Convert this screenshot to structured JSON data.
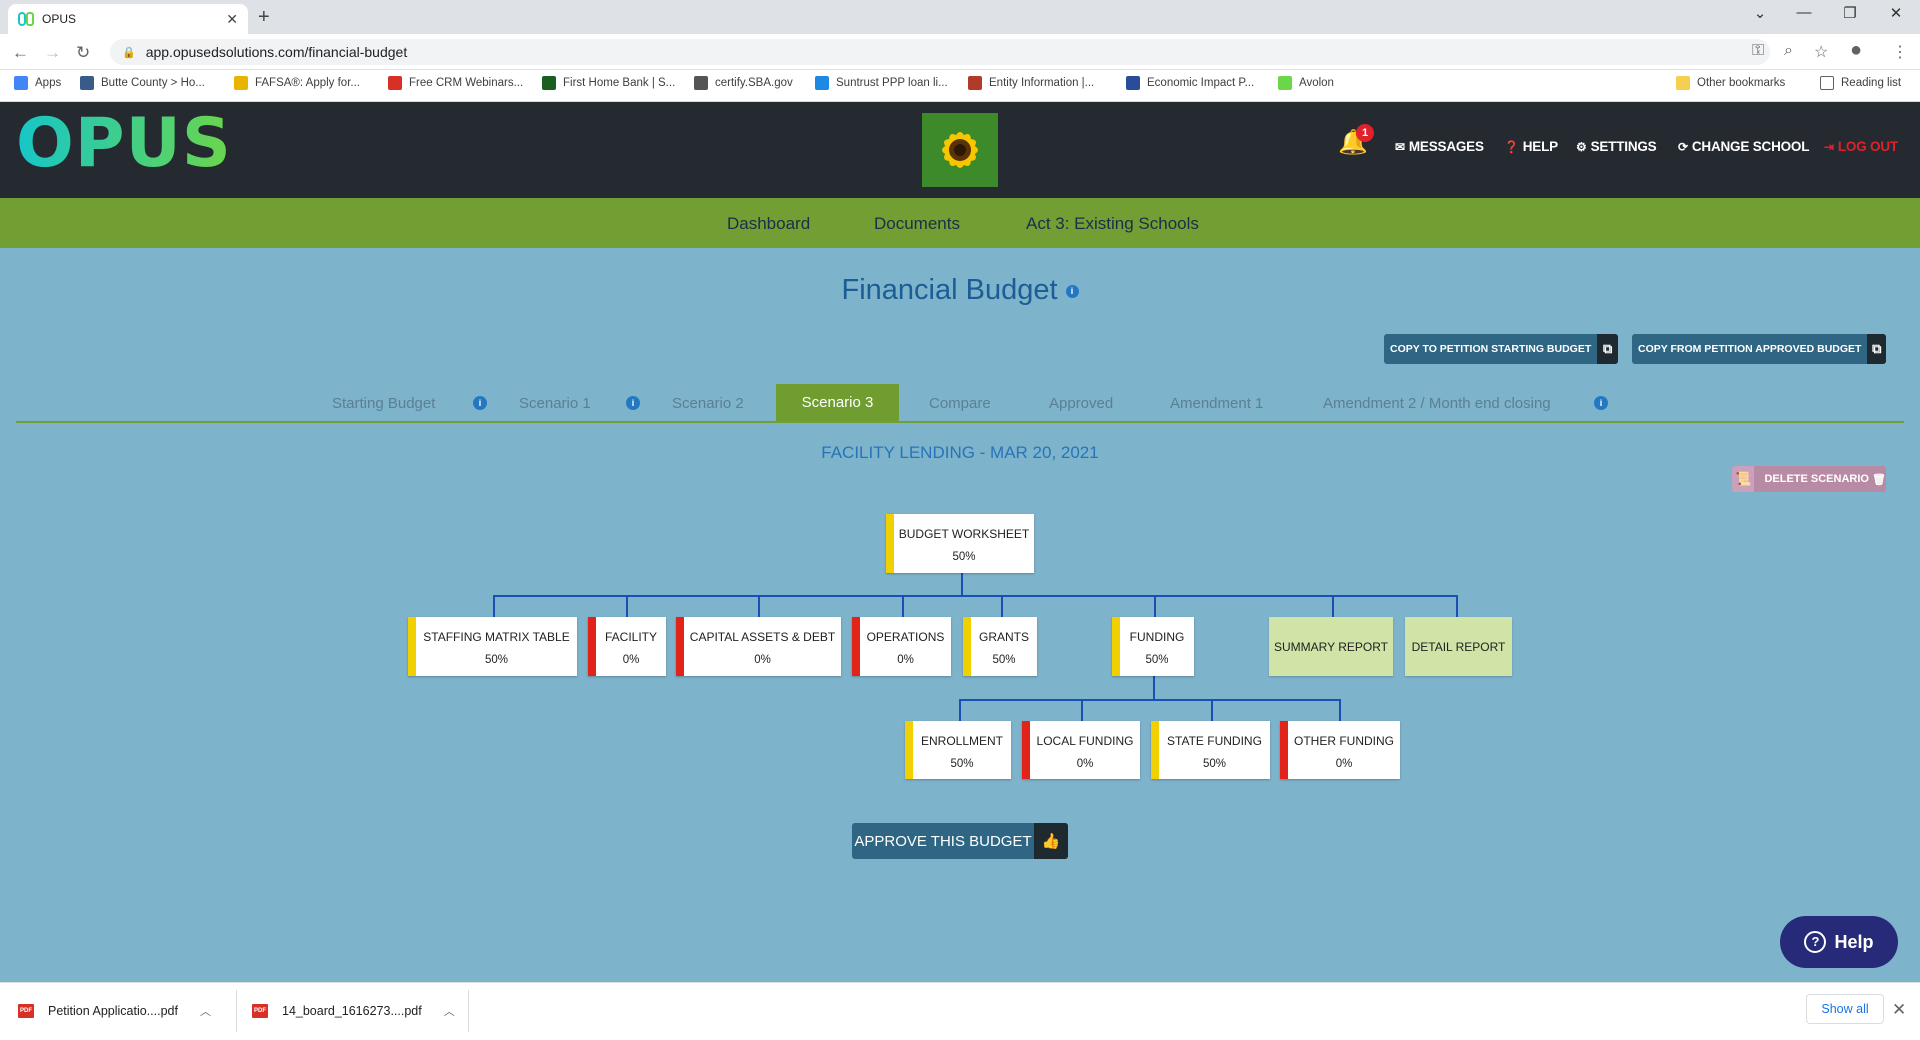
{
  "browser": {
    "tab_title": "OPUS",
    "url": "app.opusedsolutions.com/financial-budget",
    "bookmarks": [
      {
        "label": "Apps",
        "icon": "apps-grid-icon",
        "color": "#4285f4"
      },
      {
        "label": "Butte County > Ho...",
        "icon": "site-icon",
        "color": "#3a5a8a"
      },
      {
        "label": "FAFSA®: Apply for...",
        "icon": "site-icon",
        "color": "#e8b400"
      },
      {
        "label": "Free CRM Webinars...",
        "icon": "site-icon",
        "color": "#d93025"
      },
      {
        "label": "First Home Bank | S...",
        "icon": "site-icon",
        "color": "#1b5e20"
      },
      {
        "label": "certify.SBA.gov",
        "icon": "site-icon",
        "color": "#555555"
      },
      {
        "label": "Suntrust PPP loan li...",
        "icon": "site-icon",
        "color": "#1e88e5"
      },
      {
        "label": "Entity Information |...",
        "icon": "site-icon",
        "color": "#b23a2a"
      },
      {
        "label": "Economic Impact P...",
        "icon": "site-icon",
        "color": "#2a4d9b"
      },
      {
        "label": "Avolon",
        "icon": "site-icon",
        "color": "#6bd64a"
      }
    ],
    "other_bookmarks": "Other bookmarks",
    "reading_list": "Reading list"
  },
  "header": {
    "logo": "OPUS",
    "notification_count": "1",
    "menu": [
      {
        "label": "MESSAGES",
        "icon": "envelope-icon"
      },
      {
        "label": "HELP",
        "icon": "question-circle-icon"
      },
      {
        "label": "SETTINGS",
        "icon": "gear-icon"
      },
      {
        "label": "CHANGE SCHOOL",
        "icon": "refresh-icon"
      },
      {
        "label": "LOG OUT",
        "icon": "logout-icon",
        "color": "#e0202a"
      }
    ]
  },
  "nav": [
    "Dashboard",
    "Documents",
    "Act 3: Existing Schools"
  ],
  "page": {
    "title": "Financial Budget",
    "copy_starting": "COPY TO PETITION STARTING BUDGET",
    "copy_approved": "COPY FROM PETITION APPROVED BUDGET",
    "tabs": [
      "Starting Budget",
      "Scenario 1",
      "Scenario 2",
      "Scenario 3",
      "Compare",
      "Approved",
      "Amendment 1",
      "Amendment 2 / Month end closing"
    ],
    "active_tab": "Scenario 3",
    "scenario_name": "FACILITY LENDING - MAR 20, 2021",
    "delete_scenario": "DELETE SCENARIO",
    "approve_button": "APPROVE THIS BUDGET",
    "help_button": "Help"
  },
  "tree": {
    "root": {
      "label": "BUDGET WORKSHEET",
      "percent": "50%",
      "status": "yellow"
    },
    "level1": [
      {
        "label": "STAFFING MATRIX TABLE",
        "percent": "50%",
        "status": "yellow"
      },
      {
        "label": "FACILITY",
        "percent": "0%",
        "status": "red"
      },
      {
        "label": "CAPITAL ASSETS & DEBT",
        "percent": "0%",
        "status": "red"
      },
      {
        "label": "OPERATIONS",
        "percent": "0%",
        "status": "red"
      },
      {
        "label": "GRANTS",
        "percent": "50%",
        "status": "yellow"
      },
      {
        "label": "FUNDING",
        "percent": "50%",
        "status": "yellow"
      }
    ],
    "reports": [
      "SUMMARY REPORT",
      "DETAIL REPORT"
    ],
    "funding_children": [
      {
        "label": "ENROLLMENT",
        "percent": "50%",
        "status": "yellow"
      },
      {
        "label": "LOCAL FUNDING",
        "percent": "0%",
        "status": "red"
      },
      {
        "label": "STATE FUNDING",
        "percent": "50%",
        "status": "yellow"
      },
      {
        "label": "OTHER FUNDING",
        "percent": "0%",
        "status": "red"
      }
    ]
  },
  "downloads": [
    {
      "name": "Petition Applicatio....pdf"
    },
    {
      "name": "14_board_1616273....pdf"
    }
  ],
  "downloads_show_all": "Show all",
  "colors": {
    "header_bg": "#242a30",
    "nav_green": "#729f33",
    "page_bg": "#7eb3cc",
    "title_blue": "#1c5d96",
    "status_yellow": "#f0d000",
    "status_red": "#e2231a"
  }
}
